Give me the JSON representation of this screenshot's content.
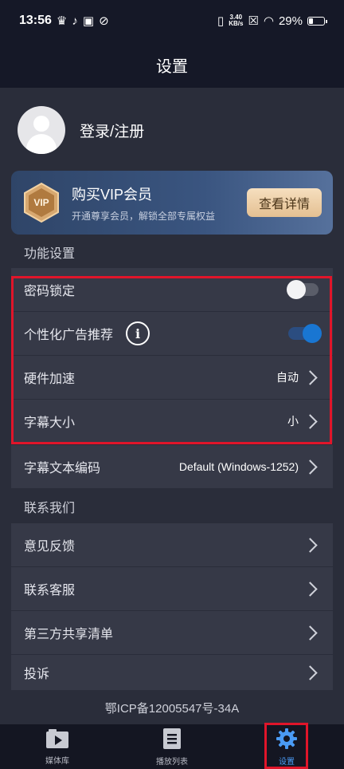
{
  "status_bar": {
    "time": "13:56",
    "net_speed_value": "3.40",
    "net_speed_unit": "KB/s",
    "battery": "29%"
  },
  "header": {
    "title": "设置"
  },
  "profile": {
    "login_label": "登录/注册"
  },
  "vip_banner": {
    "badge": "VIP",
    "title": "购买VIP会员",
    "subtitle": "开通尊享会员，解锁全部专属权益",
    "button": "查看详情"
  },
  "function_settings": {
    "heading": "功能设置",
    "items": [
      {
        "label": "密码锁定",
        "control": "toggle",
        "on": false
      },
      {
        "label": "个性化广告推荐",
        "control": "toggle",
        "on": true,
        "info_icon": "i"
      },
      {
        "label": "硬件加速",
        "value": "自动"
      },
      {
        "label": "字幕大小",
        "value": "小"
      },
      {
        "label": "字幕文本编码",
        "value": "Default (Windows-1252)"
      }
    ]
  },
  "contact": {
    "heading": "联系我们",
    "items": [
      {
        "label": "意见反馈"
      },
      {
        "label": "联系客服"
      },
      {
        "label": "第三方共享清单"
      },
      {
        "label": "投诉"
      }
    ]
  },
  "footer": {
    "icp": "鄂ICP备12005547号-34A"
  },
  "tabs": [
    {
      "label": "媒体库",
      "icon": "media-library-icon"
    },
    {
      "label": "播放列表",
      "icon": "playlist-icon"
    },
    {
      "label": "设置",
      "icon": "gear-icon",
      "active": true
    }
  ],
  "colors": {
    "accent": "#4a9bf5",
    "highlight_box": "#e0152a",
    "toggle_on": "#1976d2"
  }
}
